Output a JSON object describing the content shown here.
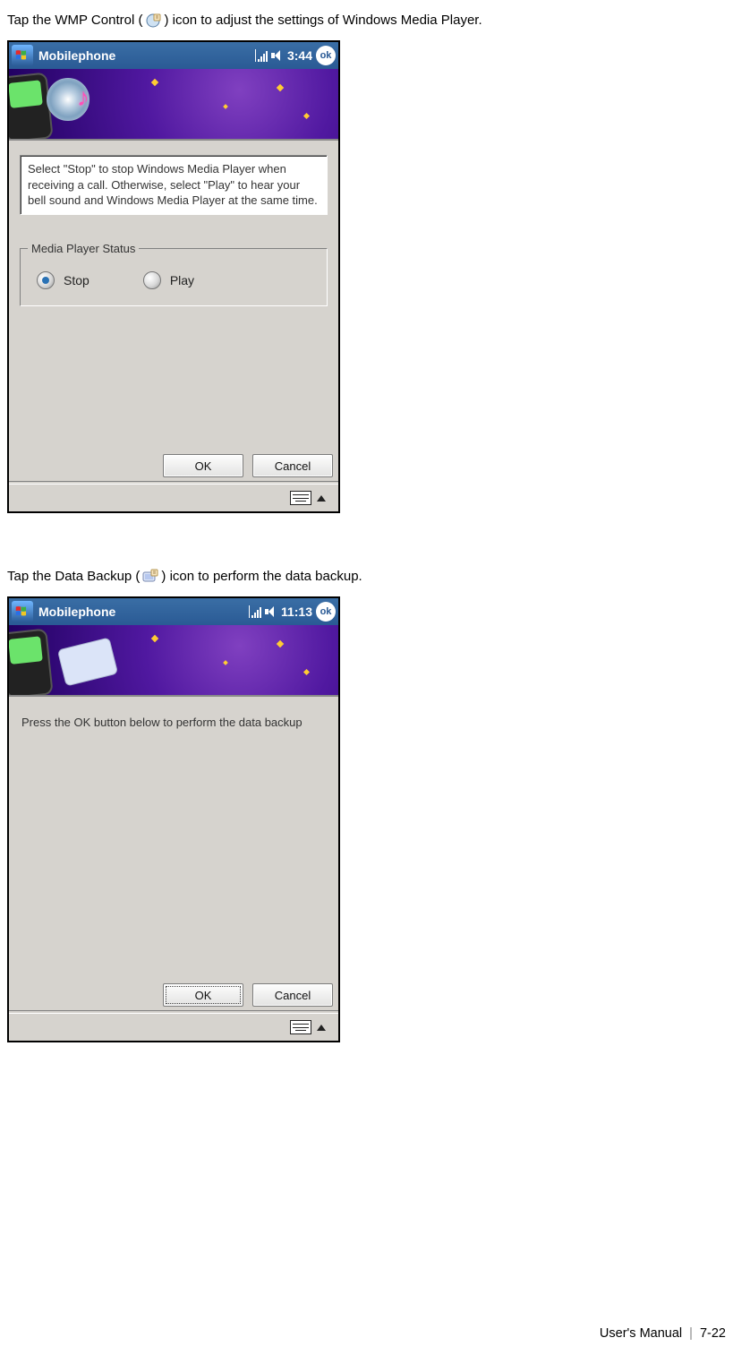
{
  "instruction1": {
    "prefix": "Tap the WMP Control (",
    "suffix": ") icon to adjust the settings of Windows Media Player."
  },
  "instruction2": {
    "prefix": "Tap the Data Backup (",
    "suffix": ") icon to perform the data backup."
  },
  "screenshot1": {
    "title": "Mobilephone",
    "time": "3:44",
    "ok_badge": "ok",
    "info_text": "Select \"Stop\" to stop Windows Media Player when receiving a call. Otherwise, select \"Play\" to hear your bell sound and Windows Media Player at the same time.",
    "group_legend": "Media Player Status",
    "options": {
      "stop": "Stop",
      "play": "Play"
    },
    "selected": "stop",
    "buttons": {
      "ok": "OK",
      "cancel": "Cancel"
    }
  },
  "screenshot2": {
    "title": "Mobilephone",
    "time": "11:13",
    "ok_badge": "ok",
    "body_text": "Press the OK button below to perform the data backup",
    "buttons": {
      "ok": "OK",
      "cancel": "Cancel"
    }
  },
  "footer": {
    "label": "User's Manual",
    "page": "7-22"
  }
}
